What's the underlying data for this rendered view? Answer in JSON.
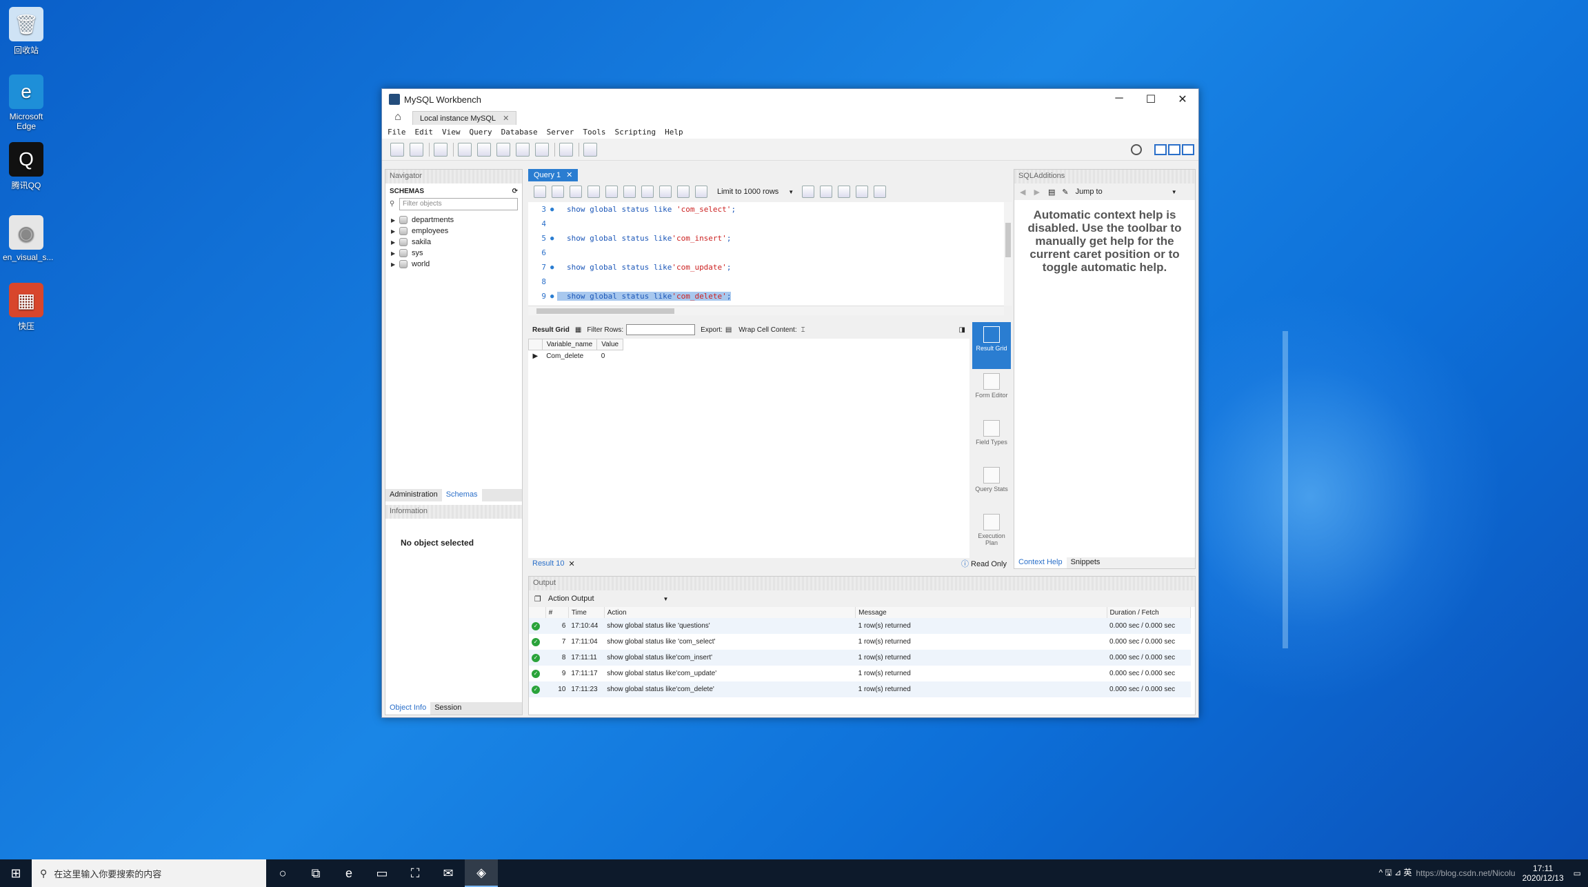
{
  "desktop": {
    "icons": [
      {
        "label": "回收站",
        "glyph": "🗑"
      },
      {
        "label": "Microsoft Edge",
        "glyph": "e"
      },
      {
        "label": "腾讯QQ",
        "glyph": "Q"
      },
      {
        "label": "en_visual_s...",
        "glyph": "◉"
      },
      {
        "label": "快压",
        "glyph": "▦"
      }
    ]
  },
  "window": {
    "title": "MySQL Workbench",
    "connection_tab": "Local instance MySQL",
    "menu": [
      "File",
      "Edit",
      "View",
      "Query",
      "Database",
      "Server",
      "Tools",
      "Scripting",
      "Help"
    ]
  },
  "navigator": {
    "header": "Navigator",
    "schemas_title": "SCHEMAS",
    "filter_placeholder": "Filter objects",
    "schemas": [
      "departments",
      "employees",
      "sakila",
      "sys",
      "world"
    ],
    "tabs": [
      "Administration",
      "Schemas"
    ],
    "info_header": "Information",
    "no_object": "No object selected",
    "bottom_tabs": [
      "Object Info",
      "Session"
    ]
  },
  "editor": {
    "query_tab": "Query 1",
    "limit": "Limit to 1000 rows",
    "lines": [
      {
        "n": "3",
        "code": "show global status like ",
        "str": "'com_select'",
        "end": ";"
      },
      {
        "n": "4",
        "code": "",
        "str": "",
        "end": ""
      },
      {
        "n": "5",
        "code": "show global status like",
        "str": "'com_insert'",
        "end": ";"
      },
      {
        "n": "6",
        "code": "",
        "str": "",
        "end": ""
      },
      {
        "n": "7",
        "code": "show global status like",
        "str": "'com_update'",
        "end": ";"
      },
      {
        "n": "8",
        "code": "",
        "str": "",
        "end": ""
      },
      {
        "n": "9",
        "code": "show global status like",
        "str": "'com_delete'",
        "end": ";"
      }
    ]
  },
  "results": {
    "result_grid_label": "Result Grid",
    "filter_rows_label": "Filter Rows:",
    "export_label": "Export:",
    "wrap_label": "Wrap Cell Content:",
    "columns": [
      "Variable_name",
      "Value"
    ],
    "rows": [
      [
        "Com_delete",
        "0"
      ]
    ],
    "side_tools": [
      "Result Grid",
      "Form Editor",
      "Field Types",
      "Query Stats",
      "Execution Plan"
    ],
    "result_tab": "Result 10",
    "read_only": "Read Only"
  },
  "sql_additions": {
    "header": "SQLAdditions",
    "jump_to": "Jump to",
    "help_text": "Automatic context help is disabled. Use the toolbar to manually get help for the current caret position or to toggle automatic help.",
    "tabs": [
      "Context Help",
      "Snippets"
    ]
  },
  "output": {
    "header": "Output",
    "selector": "Action Output",
    "columns": [
      "#",
      "Time",
      "Action",
      "Message",
      "Duration / Fetch"
    ],
    "rows": [
      {
        "n": "6",
        "time": "17:10:44",
        "action": "show global status like 'questions'",
        "message": "1 row(s) returned",
        "duration": "0.000 sec / 0.000 sec"
      },
      {
        "n": "7",
        "time": "17:11:04",
        "action": "show global status like 'com_select'",
        "message": "1 row(s) returned",
        "duration": "0.000 sec / 0.000 sec"
      },
      {
        "n": "8",
        "time": "17:11:11",
        "action": "show global status like'com_insert'",
        "message": "1 row(s) returned",
        "duration": "0.000 sec / 0.000 sec"
      },
      {
        "n": "9",
        "time": "17:11:17",
        "action": "show global status like'com_update'",
        "message": "1 row(s) returned",
        "duration": "0.000 sec / 0.000 sec"
      },
      {
        "n": "10",
        "time": "17:11:23",
        "action": "show global status like'com_delete'",
        "message": "1 row(s) returned",
        "duration": "0.000 sec / 0.000 sec"
      }
    ]
  },
  "taskbar": {
    "search_placeholder": "在这里输入你要搜索的内容",
    "tray_text": "^ 🖫 ⊿ 英",
    "time": "17:11",
    "date": "2020/12/13",
    "watermark": "https://blog.csdn.net/Nicolu"
  }
}
